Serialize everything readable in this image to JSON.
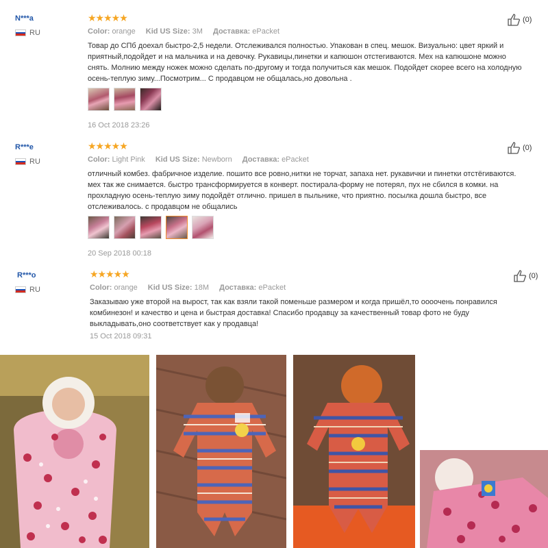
{
  "reviews": [
    {
      "user": "N***a",
      "country": "RU",
      "stars": "★★★★★",
      "color_label": "Color:",
      "color_value": "orange",
      "size_label": "Kid US Size:",
      "size_value": "3M",
      "ship_label": "Доставка:",
      "ship_value": "ePacket",
      "text": "Товар до СПб доехал быстро-2,5 недели. Отслеживался полностью. Упакован в спец. мешок. Визуально: цвет яркий и приятный,подойдет и на мальчика и на девочку. Рукавицы,пинетки и капюшон отстегиваются. Мех на капюшоне можно снять. Молнию между ножек можно сделать по-другому и тогда получиться как мешок. Подойдет скорее всего на холодную осень-теплую зиму...Посмотрим... С продавцом не общалась,но довольна .",
      "date": "16 Oct 2018 23:26",
      "likes": "(0)"
    },
    {
      "user": "R***e",
      "country": "RU",
      "stars": "★★★★★",
      "color_label": "Color:",
      "color_value": "Light Pink",
      "size_label": "Kid US Size:",
      "size_value": "Newborn",
      "ship_label": "Доставка:",
      "ship_value": "ePacket",
      "text": "отличный комбез. фабричное изделие. пошито все ровно,нитки не торчат, запаха нет. рукавички и пинетки отстёгиваются. мех так же снимается. быстро трансформируется в конверт. постирала-форму не потерял, пух не сбился в комки. на прохладную осень-теплую зиму подойдёт отлично. пришел в пыльнике, что приятно. посылка дошла быстро, все отслеживалось. с продавцом не общались",
      "date": "20 Sep 2018 00:18",
      "likes": "(0)"
    },
    {
      "user": "R***o",
      "country": "RU",
      "stars": "★★★★★",
      "color_label": "Color:",
      "color_value": "orange",
      "size_label": "Kid US Size:",
      "size_value": "18M",
      "ship_label": "Доставка:",
      "ship_value": "ePacket",
      "text": "Заказываю уже второй на вырост, так как взяли такой поменьше размером и когда пришёл,то оооочень понравился комбинезон! и качество и цена и быстрая доставка! Спасибо продавцу за качественный товар фото не буду выкладывать,оно соответствует как у продавца!",
      "date": "15 Oct 2018 09:31",
      "likes": "(0)"
    }
  ],
  "icons": {
    "like": "thumbs-up-icon",
    "flag": "russia-flag-icon"
  },
  "colors": {
    "user": "#2156a8",
    "star": "#f6a623",
    "selected_thumb": "#f08c2b"
  }
}
